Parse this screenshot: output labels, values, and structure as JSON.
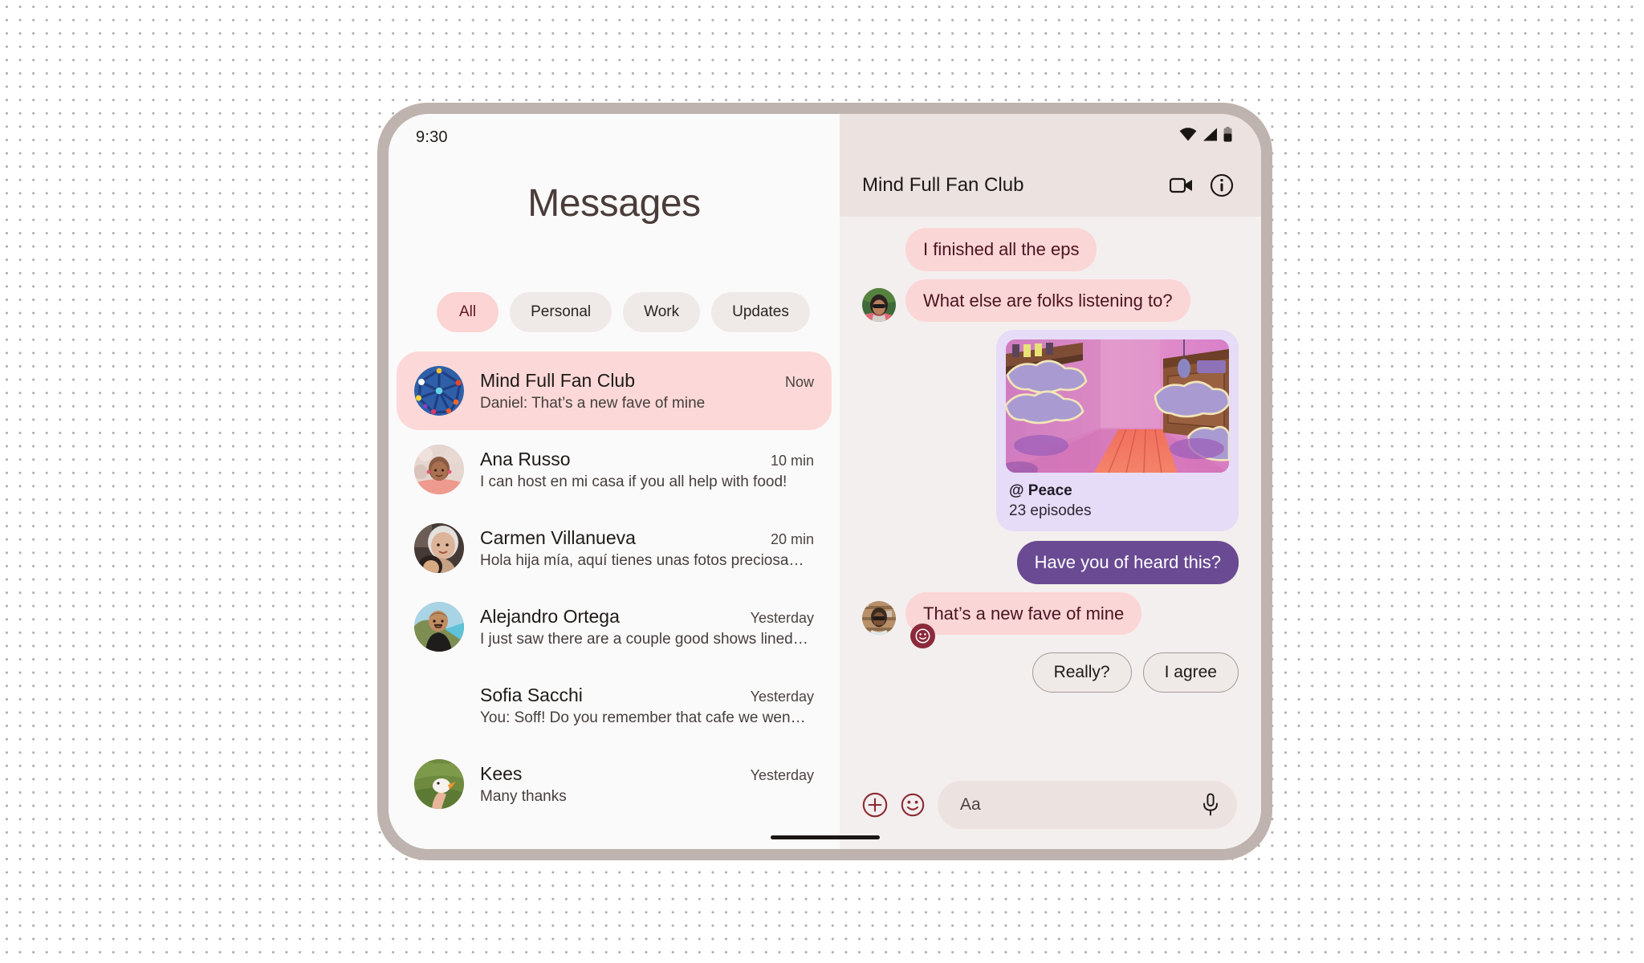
{
  "status_bar": {
    "time": "9:30",
    "icons": [
      "wifi-icon",
      "cellular-signal-icon",
      "battery-icon"
    ]
  },
  "left_pane": {
    "title": "Messages",
    "filters": [
      {
        "label": "All",
        "selected": true
      },
      {
        "label": "Personal",
        "selected": false
      },
      {
        "label": "Work",
        "selected": false
      },
      {
        "label": "Updates",
        "selected": false
      }
    ],
    "conversations": [
      {
        "name": "Mind Full Fan Club",
        "time": "Now",
        "preview": "Daniel: That’s a new fave of mine",
        "selected": true,
        "avatar": "group-network-avatar"
      },
      {
        "name": "Ana Russo",
        "time": "10 min",
        "preview": "I can host en mi casa if you all help with food!",
        "selected": false,
        "avatar": "ana-russo-avatar"
      },
      {
        "name": "Carmen Villanueva",
        "time": "20 min",
        "preview": "Hola hija mía, aquí tienes unas fotos preciosas…",
        "selected": false,
        "avatar": "carmen-villanueva-avatar"
      },
      {
        "name": "Alejandro Ortega",
        "time": "Yesterday",
        "preview": "I just saw there are a couple good shows lined…",
        "selected": false,
        "avatar": "alejandro-ortega-avatar"
      },
      {
        "name": "Sofia Sacchi",
        "time": "Yesterday",
        "preview": "You: Soff! Do you remember that cafe we went…",
        "selected": false,
        "avatar": "none"
      },
      {
        "name": "Kees",
        "time": "Yesterday",
        "preview": "Many thanks",
        "selected": false,
        "avatar": "kees-avatar"
      }
    ]
  },
  "chat": {
    "title": "Mind Full Fan Club",
    "header_icons": [
      "video-call-icon",
      "info-icon"
    ],
    "messages": [
      {
        "text": "I finished all the eps",
        "direction": "in",
        "show_avatar": false
      },
      {
        "text": "What else are folks listening to?",
        "direction": "in",
        "show_avatar": true
      },
      {
        "text": "Have you of heard this?",
        "direction": "out",
        "show_avatar": false
      },
      {
        "text": "That’s a new fave of mine",
        "direction": "in",
        "show_avatar": true,
        "reaction": "smiley-reaction"
      }
    ],
    "media_card": {
      "title": "@ Peace",
      "subtitle": "23 episodes",
      "thumbnail": "podcast-room-illustration"
    },
    "suggestions": [
      "Really?",
      "I agree"
    ],
    "composer": {
      "placeholder": "Aa",
      "attach_icon": "plus-circle-icon",
      "emoji_icon": "emoji-smiley-icon",
      "mic_icon": "microphone-icon"
    }
  },
  "colors": {
    "accent_pink": "#FCD9D8",
    "bubble_in": "#FBD6D6",
    "bubble_out": "#6A4A93",
    "header_surface": "#ECE2E0",
    "chat_surface": "#F3EFEE",
    "list_surface": "#FBFAFA",
    "frame": "#BEB3AF",
    "reaction_badge": "#8C2A3C",
    "media_card": "#E6DCF7"
  }
}
